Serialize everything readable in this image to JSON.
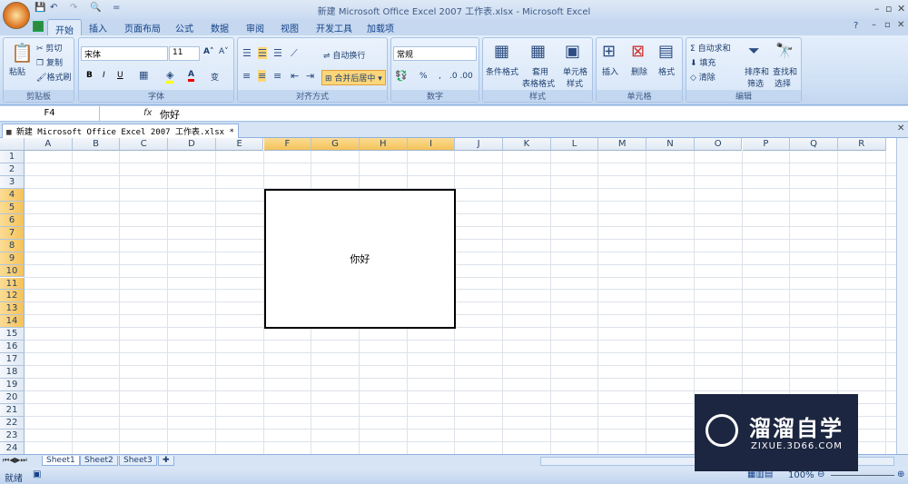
{
  "window": {
    "title": "新建 Microsoft Office Excel 2007 工作表.xlsx - Microsoft Excel"
  },
  "quick_access": {
    "qa_more": "="
  },
  "tabs": [
    "开始",
    "插入",
    "页面布局",
    "公式",
    "数据",
    "审阅",
    "视图",
    "开发工具",
    "加载项"
  ],
  "ribbon": {
    "clipboard": {
      "label": "剪贴板",
      "paste": "粘贴",
      "cut": "剪切",
      "copy": "复制",
      "format_painter": "格式刷"
    },
    "font": {
      "label": "字体",
      "font_name": "宋体",
      "font_size": "11",
      "bold": "B",
      "italic": "I",
      "underline": "U",
      "grow": "A˄",
      "shrink": "A˅",
      "font_color": "A",
      "phonetic": "变"
    },
    "alignment": {
      "label": "对齐方式",
      "wrap": "自动换行",
      "merge": "合并后居中"
    },
    "number": {
      "label": "数字",
      "format": "常规",
      "percent": "%",
      "comma": ","
    },
    "styles": {
      "label": "样式",
      "conditional": "条件格式",
      "table1": "套用",
      "table2": "表格格式",
      "cell1": "单元格",
      "cell2": "样式"
    },
    "cells": {
      "label": "单元格",
      "insert": "插入",
      "delete": "删除",
      "format": "格式"
    },
    "editing": {
      "label": "编辑",
      "autosum": "自动求和",
      "fill": "填充",
      "clear": "清除",
      "sort1": "排序和",
      "sort2": "筛选",
      "find1": "查找和",
      "find2": "选择"
    }
  },
  "formula_bar": {
    "name_box": "F4",
    "fx": "fx",
    "value": "你好"
  },
  "workbook_tab": {
    "title": "新建 Microsoft Office Excel 2007 工作表.xlsx *"
  },
  "grid": {
    "columns": [
      "A",
      "B",
      "C",
      "D",
      "E",
      "F",
      "G",
      "H",
      "I",
      "J",
      "K",
      "L",
      "M",
      "N",
      "O",
      "P",
      "Q",
      "R"
    ],
    "selected_columns": [
      "F",
      "G",
      "H",
      "I"
    ],
    "rows": 24,
    "selected_rows": [
      4,
      14
    ],
    "merged_cell_value": "你好"
  },
  "sheets": [
    "Sheet1",
    "Sheet2",
    "Sheet3"
  ],
  "status": {
    "ready": "就绪",
    "zoom": "100%"
  },
  "watermark": {
    "brand": "溜溜自学",
    "url": "ZIXUE.3D66.COM"
  }
}
